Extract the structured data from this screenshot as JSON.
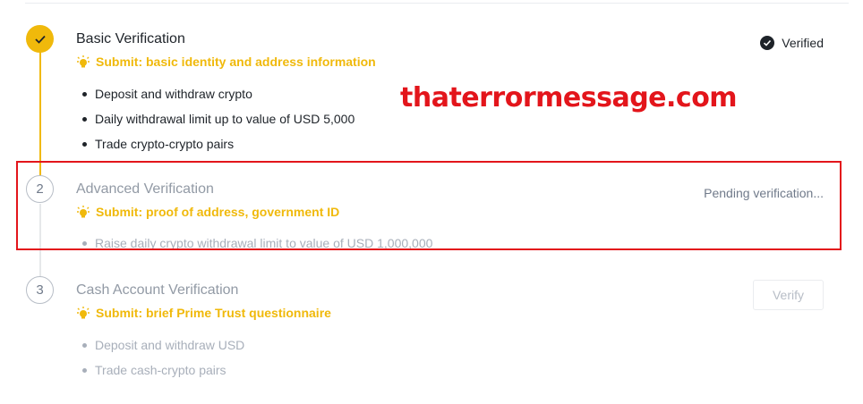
{
  "steps": [
    {
      "number": "",
      "title": "Basic Verification",
      "submit": "Submit: basic identity and address information",
      "status": "Verified",
      "items": [
        "Deposit and withdraw crypto",
        "Daily withdrawal limit up to value of USD 5,000",
        "Trade crypto-crypto pairs"
      ]
    },
    {
      "number": "2",
      "title": "Advanced Verification",
      "submit": "Submit: proof of address, government ID",
      "status": "Pending verification...",
      "items": [
        "Raise daily crypto withdrawal limit to value of USD 1,000,000"
      ]
    },
    {
      "number": "3",
      "title": "Cash Account Verification",
      "submit": "Submit: brief Prime Trust questionnaire",
      "action_label": "Verify",
      "items": [
        "Deposit and withdraw USD",
        "Trade cash-crypto pairs"
      ]
    }
  ],
  "watermark": "thaterrormessage.com",
  "colors": {
    "accent": "#f0b90b",
    "highlight": "#e3151b",
    "muted_text": "#929aa5"
  },
  "icons": {
    "completed": "check-icon",
    "tip": "lightbulb-icon",
    "verified": "check-circle-icon"
  }
}
